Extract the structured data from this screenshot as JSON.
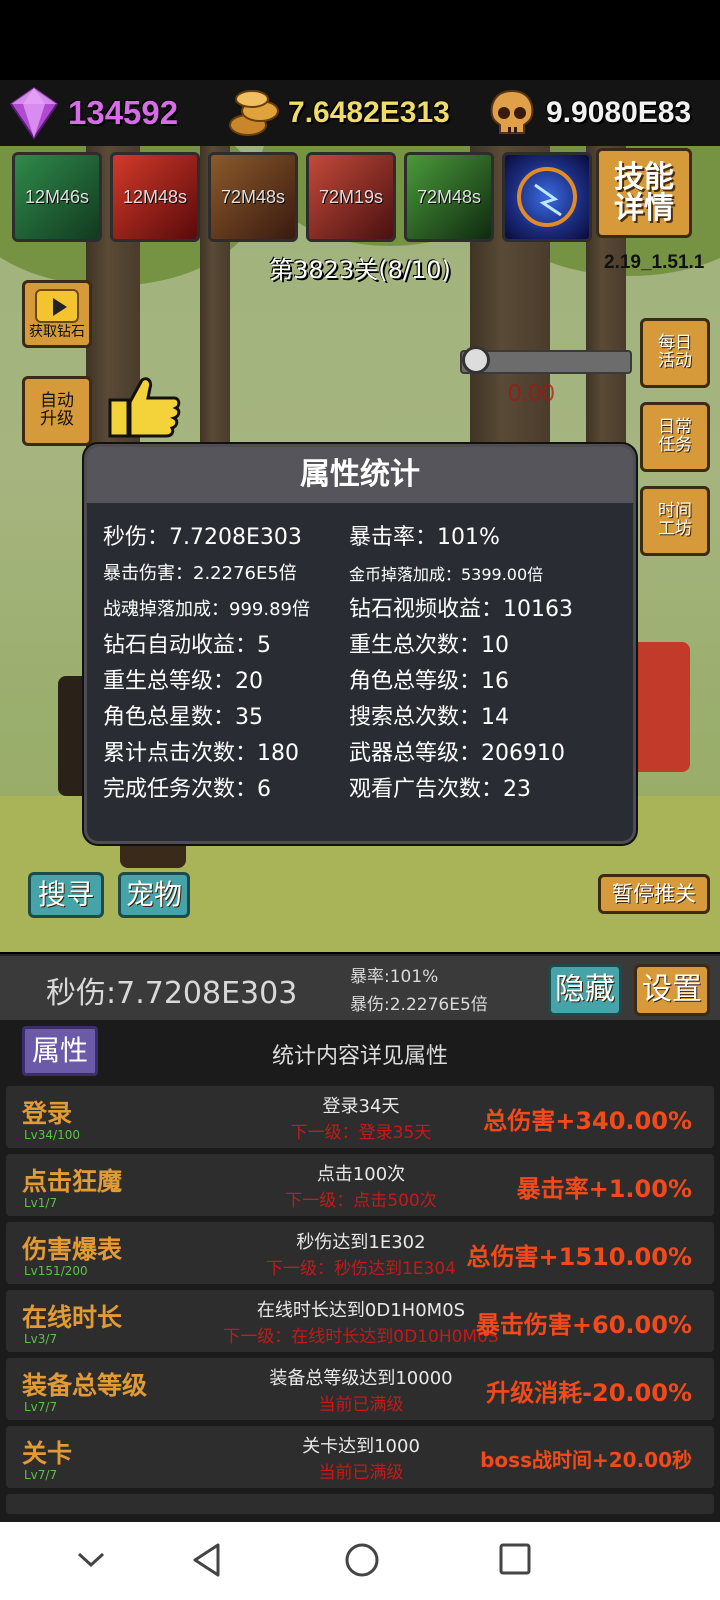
{
  "currencies": {
    "diamond": "134592",
    "gold": "7.6482E313",
    "soul": "9.9080E83"
  },
  "skills": [
    {
      "time": "12M46s",
      "icon": "skill-wind-icon",
      "color": "#2f8a4a"
    },
    {
      "time": "12M48s",
      "icon": "skill-strike-icon",
      "color": "#b02a2a"
    },
    {
      "time": "72M48s",
      "icon": "skill-stars-icon",
      "color": "#7a4a22"
    },
    {
      "time": "72M19s",
      "icon": "skill-warrior-icon",
      "color": "#a83a2a"
    },
    {
      "time": "72M48s",
      "icon": "skill-bow-icon",
      "color": "#3a7a2a"
    },
    {
      "time": "",
      "icon": "skill-lightning-icon",
      "color": "#1a3a9a"
    }
  ],
  "skill_detail_label": "技能\n详情",
  "stage": "第3823关(8/10)",
  "version": "2.19_1.51.1",
  "buttons": {
    "video_diamond": "获取钻石",
    "auto_upgrade": "自动\n升级",
    "daily_activity": "每日\n活动",
    "daily_task": "日常\n任务",
    "time_workshop": "时间\n工坊",
    "search": "搜寻",
    "pet": "宠物",
    "pause_push": "暂停推关",
    "hide": "隐藏",
    "settings": "设置"
  },
  "boss_timer": "0.00",
  "modal": {
    "title": "属性统计",
    "stats": [
      {
        "label": "秒伤：7.7208E303",
        "size": "normal"
      },
      {
        "label": "暴击率：101%",
        "size": "normal"
      },
      {
        "label": "暴击伤害：2.2276E5倍",
        "size": "small"
      },
      {
        "label": "金币掉落加成：5399.00倍",
        "size": "tiny"
      },
      {
        "label": "战魂掉落加成：999.89倍",
        "size": "small"
      },
      {
        "label": "钻石视频收益：10163",
        "size": "normal"
      },
      {
        "label": "钻石自动收益：5",
        "size": "normal"
      },
      {
        "label": "重生总次数：10",
        "size": "normal"
      },
      {
        "label": "重生总等级：20",
        "size": "normal"
      },
      {
        "label": "角色总等级：16",
        "size": "normal"
      },
      {
        "label": "角色总星数：35",
        "size": "normal"
      },
      {
        "label": "搜索总次数：14",
        "size": "normal"
      },
      {
        "label": "累计点击次数：180",
        "size": "normal"
      },
      {
        "label": "武器总等级：206910",
        "size": "normal"
      },
      {
        "label": "完成任务次数：6",
        "size": "normal"
      },
      {
        "label": "观看广告次数：23",
        "size": "normal"
      }
    ]
  },
  "dps_bar": {
    "dps": "秒伤:7.7208E303",
    "crit_rate": "暴率:101%",
    "crit_damage": "暴伤:2.2276E5倍"
  },
  "panel": {
    "tab": "属性",
    "tip": "统计内容详见属性",
    "rows": [
      {
        "title": "登录",
        "level": "Lv34/100",
        "cond": "登录34天",
        "next": "下一级：登录35天",
        "bonus": "总伤害+340.00%"
      },
      {
        "title": "点击狂魔",
        "level": "Lv1/7",
        "cond": "点击100次",
        "next": "下一级：点击500次",
        "bonus": "暴击率+1.00%"
      },
      {
        "title": "伤害爆表",
        "level": "Lv151/200",
        "cond": "秒伤达到1E302",
        "next": "下一级：秒伤达到1E304",
        "bonus": "总伤害+1510.00%"
      },
      {
        "title": "在线时长",
        "level": "Lv3/7",
        "cond": "在线时长达到0D1H0M0S",
        "next": "下一级：在线时长达到0D10H0M0S",
        "bonus": "暴击伤害+60.00%"
      },
      {
        "title": "装备总等级",
        "level": "Lv7/7",
        "cond": "装备总等级达到10000",
        "next": "当前已满级",
        "bonus": "升级消耗-20.00%"
      },
      {
        "title": "关卡",
        "level": "Lv7/7",
        "cond": "关卡达到1000",
        "next": "当前已满级",
        "bonus": "boss战时间+20.00秒"
      }
    ]
  }
}
